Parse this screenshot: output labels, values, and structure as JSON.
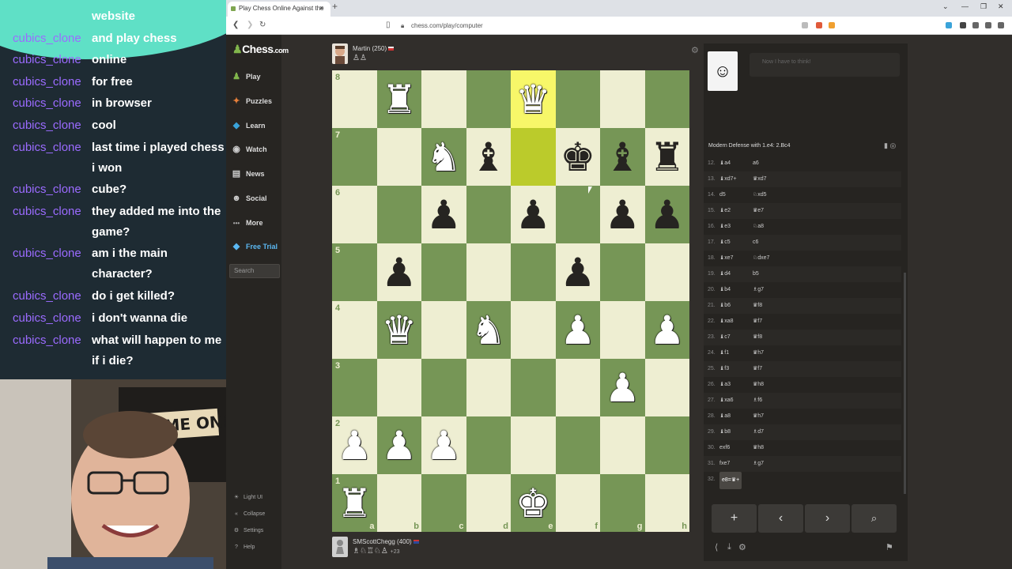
{
  "chat": {
    "messages": [
      {
        "user": "",
        "text": "website"
      },
      {
        "user": "cubics_clone",
        "text": "and play chess"
      },
      {
        "user": "cubics_clone",
        "text": "online"
      },
      {
        "user": "cubics_clone",
        "text": "for free"
      },
      {
        "user": "cubics_clone",
        "text": "in browser"
      },
      {
        "user": "cubics_clone",
        "text": "cool"
      },
      {
        "user": "cubics_clone",
        "text": "last time i played chess i won"
      },
      {
        "user": "cubics_clone",
        "text": "cube?"
      },
      {
        "user": "cubics_clone",
        "text": "they added me into the game?"
      },
      {
        "user": "cubics_clone",
        "text": "am i the main character?"
      },
      {
        "user": "cubics_clone",
        "text": "do i get killed?"
      },
      {
        "user": "cubics_clone",
        "text": "i don't wanna die"
      },
      {
        "user": "cubics_clone",
        "text": "what will happen to me if i die?"
      }
    ],
    "webcam_sign": "AME ON!"
  },
  "browser": {
    "tab_title": "Play Chess Online Against the",
    "tab_close": "×",
    "new_tab": "+",
    "url": "chess.com/play/computer",
    "window_controls": [
      "⌄",
      "—",
      "❐",
      "✕"
    ]
  },
  "sidebar": {
    "logo_word": "Chess",
    "logo_suffix": ".com",
    "items": [
      {
        "label": "Play",
        "icon": "♟",
        "icon_name": "play-icon",
        "color": "#81b64c"
      },
      {
        "label": "Puzzles",
        "icon": "✦",
        "icon_name": "puzzle-icon",
        "color": "#e8803a"
      },
      {
        "label": "Learn",
        "icon": "◆",
        "icon_name": "learn-icon",
        "color": "#3aa3d9"
      },
      {
        "label": "Watch",
        "icon": "◉",
        "icon_name": "binoculars-icon",
        "color": "#cccccc"
      },
      {
        "label": "News",
        "icon": "▤",
        "icon_name": "news-icon",
        "color": "#cccccc"
      },
      {
        "label": "Social",
        "icon": "☻",
        "icon_name": "social-icon",
        "color": "#cccccc"
      },
      {
        "label": "More",
        "icon": "•••",
        "icon_name": "more-icon",
        "color": "#aaaaaa"
      },
      {
        "label": "Free Trial",
        "icon": "◆",
        "icon_name": "diamond-icon",
        "color": "#5bb8f2"
      }
    ],
    "search_placeholder": "Search",
    "footer": [
      {
        "label": "Light UI",
        "icon": "☀",
        "icon_name": "sun-icon"
      },
      {
        "label": "Collapse",
        "icon": "«",
        "icon_name": "collapse-icon"
      },
      {
        "label": "Settings",
        "icon": "⚙",
        "icon_name": "gear-icon"
      },
      {
        "label": "Help",
        "icon": "?",
        "icon_name": "help-icon"
      }
    ]
  },
  "top_player": {
    "name": "Martin",
    "rating": "(250)",
    "captured": "♙♙"
  },
  "bottom_player": {
    "name": "SMScottChegg",
    "rating": "(400)",
    "captured": "♗♘♖♘♙",
    "advantage": "+23"
  },
  "board": {
    "ranks": [
      "8",
      "7",
      "6",
      "5",
      "4",
      "3",
      "2",
      "1"
    ],
    "files": [
      "a",
      "b",
      "c",
      "d",
      "e",
      "f",
      "g",
      "h"
    ],
    "highlighted": [
      "e8",
      "e7"
    ],
    "pieces": {
      "b8": "wR",
      "e8": "wQ",
      "c7": "wN",
      "d7": "bB",
      "f7": "bK",
      "g7": "bB",
      "h7": "bR",
      "c6": "bP",
      "e6": "bP",
      "g6": "bP",
      "h6": "bP",
      "b5": "bP",
      "f5": "bP",
      "b4": "wQ",
      "d4": "wN",
      "f4": "wP",
      "h4": "wP",
      "g3": "wP",
      "a2": "wP",
      "b2": "wP",
      "c2": "wP",
      "a1": "wR",
      "e1": "wK"
    }
  },
  "panel": {
    "bot_avatar": "☺",
    "bot_message": "Now I have to think!",
    "opening": "Modern Defense with 1.e4: 2.Bc4",
    "moves": [
      {
        "n": "12.",
        "w": "♝a4",
        "b": "a6"
      },
      {
        "n": "13.",
        "w": "♝xd7+",
        "b": "♛xd7"
      },
      {
        "n": "14.",
        "w": "d5",
        "b": "♘xd5"
      },
      {
        "n": "15.",
        "w": "♝e2",
        "b": "♛e7"
      },
      {
        "n": "16.",
        "w": "♝e3",
        "b": "♘a8"
      },
      {
        "n": "17.",
        "w": "♝c5",
        "b": "c6"
      },
      {
        "n": "18.",
        "w": "♝xe7",
        "b": "♘dxe7"
      },
      {
        "n": "19.",
        "w": "♝d4",
        "b": "b5"
      },
      {
        "n": "20.",
        "w": "♝b4",
        "b": "♗g7"
      },
      {
        "n": "21.",
        "w": "♝b6",
        "b": "♛f8"
      },
      {
        "n": "22.",
        "w": "♝xa8",
        "b": "♛f7"
      },
      {
        "n": "23.",
        "w": "♝c7",
        "b": "♛f8"
      },
      {
        "n": "24.",
        "w": "♝f1",
        "b": "♛h7"
      },
      {
        "n": "25.",
        "w": "♝f3",
        "b": "♛f7"
      },
      {
        "n": "26.",
        "w": "♝a3",
        "b": "♛h8"
      },
      {
        "n": "27.",
        "w": "♝xa6",
        "b": "♗f6"
      },
      {
        "n": "28.",
        "w": "♝a8",
        "b": "♛h7"
      },
      {
        "n": "29.",
        "w": "♝b8",
        "b": "♗d7"
      },
      {
        "n": "30.",
        "w": "exf6",
        "b": "♛h8"
      },
      {
        "n": "31.",
        "w": "fxe7",
        "b": "♗g7"
      },
      {
        "n": "32.",
        "w": "e8=♛+",
        "b": ""
      }
    ],
    "controls": [
      "+",
      "‹",
      "›",
      "⌕"
    ],
    "bottom_icons": [
      "⟨",
      "⤓",
      "⚙",
      "⚑"
    ]
  }
}
